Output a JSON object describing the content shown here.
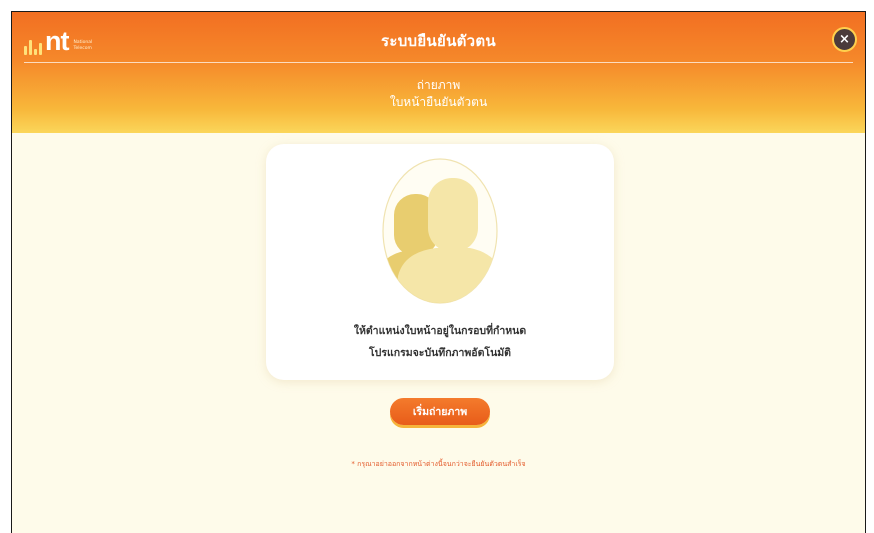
{
  "header": {
    "logo_text": "nt",
    "logo_sub_line1": "National",
    "logo_sub_line2": "Telecom",
    "title": "ระบบยืนยันตัวตน",
    "subtitle_line1": "ถ่ายภาพ",
    "subtitle_line2": "ใบหน้ายืนยันตัวตน",
    "close_icon": "×"
  },
  "card": {
    "instruction_line1": "ให้ตำแหน่งใบหน้าอยู่ในกรอบที่กำหนด",
    "instruction_line2": "โปรแกรมจะบันทึกภาพอัตโนมัติ"
  },
  "actions": {
    "start_label": "เริ่มถ่ายภาพ"
  },
  "note": "* กรุณาอย่าออกจากหน้าต่างนี้จนกว่าจะยืนยันตัวตนสำเร็จ",
  "colors": {
    "header_top": "#f26f22",
    "header_bottom": "#fbd65a",
    "background": "#fefbea",
    "button": "#e85c19",
    "note": "#e35a2a",
    "silhouette_back": "#e8cd6f",
    "silhouette_front": "#f5e6a8"
  },
  "icons": {
    "close": "close-icon",
    "face": "face-silhouette-icon"
  }
}
